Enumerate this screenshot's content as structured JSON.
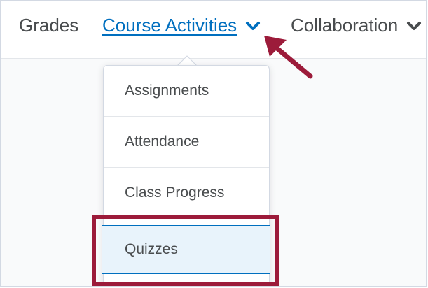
{
  "navbar": {
    "items": [
      {
        "label": "Grades"
      },
      {
        "label": "Course Activities",
        "active": true
      },
      {
        "label": "Collaboration"
      }
    ]
  },
  "dropdown": {
    "items": [
      {
        "label": "Assignments"
      },
      {
        "label": "Attendance"
      },
      {
        "label": "Class Progress"
      },
      {
        "label": "Quizzes",
        "highlighted": true
      }
    ]
  },
  "colors": {
    "link": "#006fbf",
    "text": "#494c4e",
    "highlight_box": "#9c1b3a",
    "selected_bg": "#e8f3fb"
  },
  "icons": {
    "active_chevron": "chevron-down-icon",
    "collab_chevron": "chevron-down-icon",
    "annotation": "arrow-pointer-icon"
  }
}
